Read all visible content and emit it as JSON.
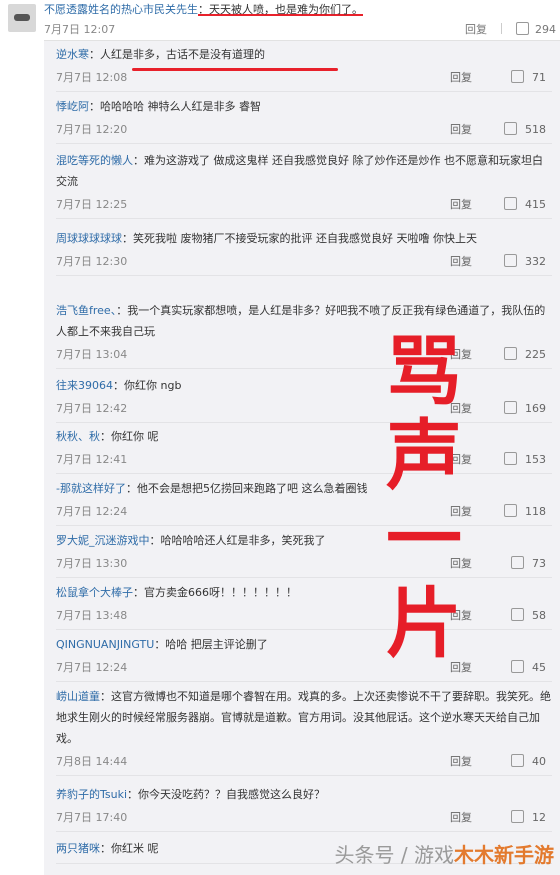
{
  "top": {
    "user": "不愿透露姓名的热心市民关先生",
    "text": "：天天被人喷，也是难为你们了。",
    "time": "7月7日 12:07",
    "reply": "回复",
    "likes": "294"
  },
  "comments": [
    {
      "user": "逆水寒",
      "pre": "",
      "text": "：人红是非多，古话不是没有道理的",
      "time": "7月7日 12:08",
      "reply": "回复",
      "likes": "71"
    },
    {
      "user": "悸屹阿",
      "pre": "",
      "text": "：哈哈哈哈 神特么人红是非多 睿智",
      "time": "7月7日 12:20",
      "reply": "回复",
      "likes": "518"
    },
    {
      "user": "混吃等死的懒人",
      "pre": "",
      "text": "：难为这游戏了 做成这鬼样 还自我感觉良好 除了炒作还是炒作 也不愿意和玩家坦白交流",
      "time": "7月7日 12:25",
      "reply": "回复",
      "likes": "415"
    },
    {
      "user": "周球球球球球",
      "pre": "",
      "text": "：笑死我啦 废物猪厂不接受玩家的批评 还自我感觉良好 天啦噜 你快上天",
      "time": "7月7日 12:30",
      "reply": "回复",
      "likes": "332"
    },
    {
      "user": "浩飞鱼free、",
      "pre": "",
      "text": "：我一个真实玩家都想喷，是人红是非多？好吧我不喷了反正我有绿色通道了，我队伍的人都上不来我自己玩",
      "time": "7月7日 13:04",
      "reply": "回复",
      "likes": "225"
    },
    {
      "user": "往来39064",
      "pre": "",
      "text": "：你红你 ngb",
      "time": "7月7日 12:42",
      "reply": "回复",
      "likes": "169"
    },
    {
      "user": "秋秋、秋",
      "pre": "",
      "text": "：你红你 呢",
      "time": "7月7日 12:41",
      "reply": "回复",
      "likes": "153"
    },
    {
      "user": "-那就这样好了",
      "pre": "",
      "text": "：他不会是想把5亿捞回来跑路了吧 这么急着圈钱",
      "time": "7月7日 12:24",
      "reply": "回复",
      "likes": "118"
    },
    {
      "user": "罗大妮_沉迷游戏中",
      "pre": "",
      "text": "：哈哈哈哈还人红是非多，笑死我了",
      "time": "7月7日 13:30",
      "reply": "回复",
      "likes": "73"
    },
    {
      "user": "松鼠拿个大棒子",
      "pre": "",
      "text": "：官方卖金666呀！！！！！！！",
      "time": "7月7日 13:48",
      "reply": "回复",
      "likes": "58"
    },
    {
      "user": "QINGNUANJINGTU",
      "pre": "",
      "text": "：哈哈 把层主评论删了",
      "time": "7月7日 12:24",
      "reply": "回复",
      "likes": "45"
    },
    {
      "user": "崂山道童",
      "pre": "",
      "text": "：这官方微博也不知道是哪个睿智在用。戏真的多。上次还卖惨说不干了要辞职。我笑死。绝地求生刚火的时候经常服务器崩。官博就是道歉。官方用词。没其他屁话。这个逆水寒天天给自己加戏。",
      "time": "7月8日 14:44",
      "reply": "回复",
      "likes": "40"
    },
    {
      "user": "养豹子的Tsuki",
      "pre": "",
      "text": "：你今天没吃药？？自我感觉这么良好？",
      "time": "7月7日 17:40",
      "reply": "回复",
      "likes": "12"
    },
    {
      "user": "两只猪咪",
      "pre": "",
      "text": "：你红米 呢",
      "time": "",
      "reply": "",
      "likes": ""
    }
  ],
  "overlay": [
    "骂",
    "声",
    "一",
    "片"
  ],
  "watermark": {
    "prefix": "头条号 / 游戏",
    "site": "木木新手游"
  },
  "colors": {
    "username": "#2f6ca8",
    "accent_red": "#e61e28",
    "panel_bg": "#f2f2f5"
  }
}
